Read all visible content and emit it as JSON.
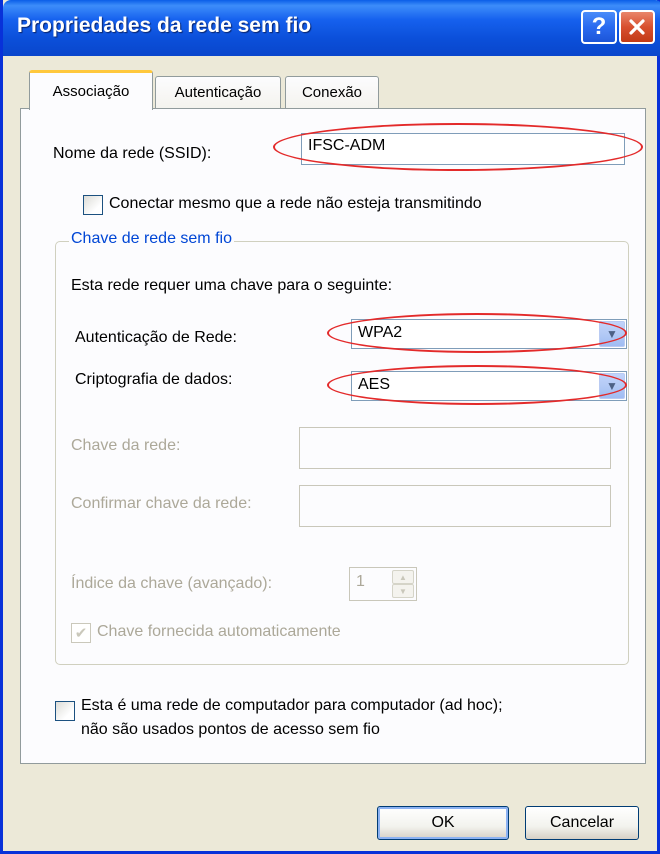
{
  "window": {
    "title": "Propriedades da rede sem fio",
    "help_glyph": "?",
    "close_glyph": "✕"
  },
  "tabs": [
    {
      "label": "Associação",
      "active": true
    },
    {
      "label": "Autenticação",
      "active": false
    },
    {
      "label": "Conexão",
      "active": false
    }
  ],
  "association": {
    "ssid_label": "Nome da rede (SSID):",
    "ssid_value": "IFSC-ADM",
    "broadcast_checkbox_label": "Conectar mesmo que a rede não esteja transmitindo",
    "broadcast_checked": false
  },
  "wireless_key_group": {
    "title": "Chave de rede sem fio",
    "description": "Esta rede requer uma chave para o seguinte:",
    "auth_label": "Autenticação de Rede:",
    "auth_value": "WPA2",
    "encryption_label": "Criptografia de dados:",
    "encryption_value": "AES",
    "network_key_label": "Chave da rede:",
    "network_key_value": "",
    "confirm_key_label": "Confirmar chave da rede:",
    "confirm_key_value": "",
    "key_index_label": "Índice da chave (avançado):",
    "key_index_value": "1",
    "auto_key_label": "Chave fornecida automaticamente",
    "auto_key_checked": true
  },
  "adhoc": {
    "label_line1": "Esta é uma rede de computador para  computador (ad hoc);",
    "label_line2": "não são usados pontos de acesso sem fio",
    "checked": false
  },
  "buttons": {
    "ok": "OK",
    "cancel": "Cancelar"
  },
  "colors": {
    "titlebar": "#0a5ee8",
    "highlight_ellipse": "#e32a2a",
    "group_title": "#0046d5"
  }
}
